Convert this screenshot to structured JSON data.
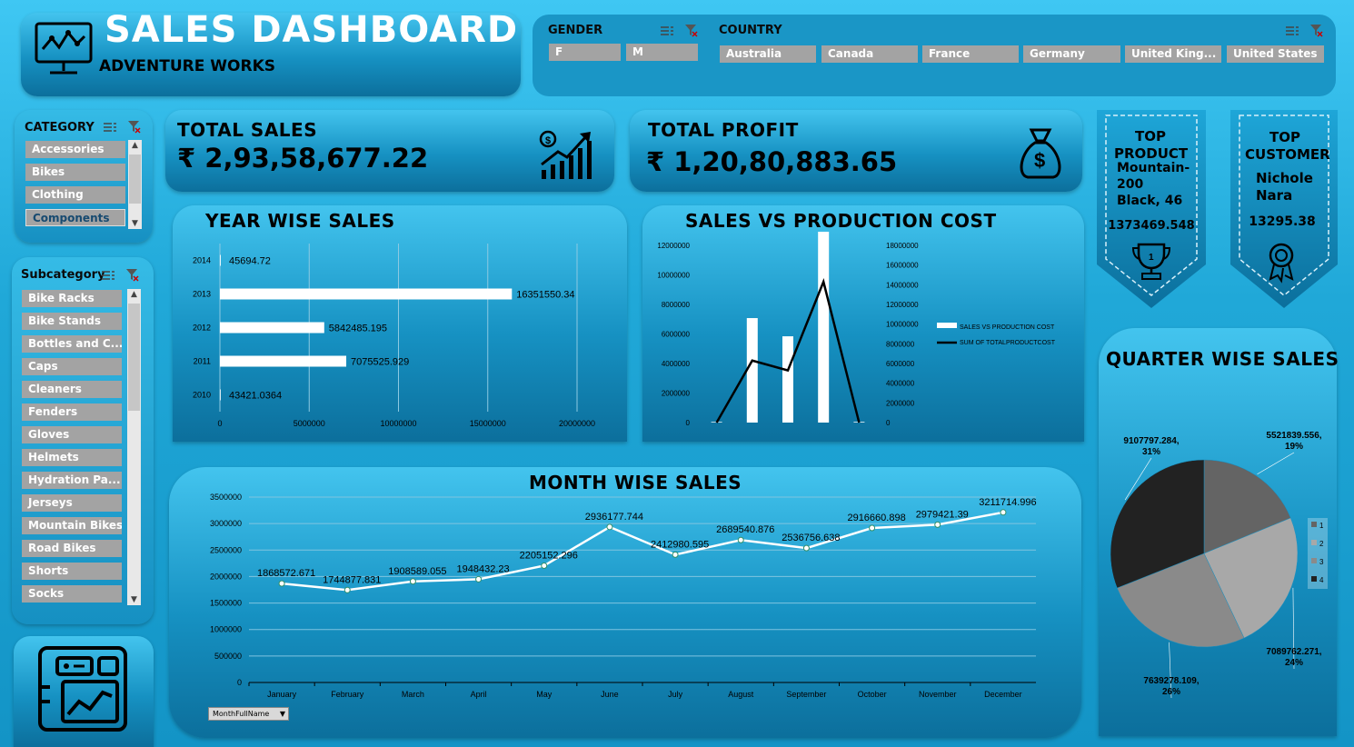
{
  "header": {
    "title": "SALES DASHBOARD",
    "subtitle": "ADVENTURE WORKS"
  },
  "gender": {
    "title": "GENDER",
    "items": [
      "F",
      "M"
    ]
  },
  "country": {
    "title": "COUNTRY",
    "items": [
      "Australia",
      "Canada",
      "France",
      "Germany",
      "United King...",
      "United States"
    ]
  },
  "category": {
    "title": "CATEGORY",
    "items": [
      "Accessories",
      "Bikes",
      "Clothing",
      "Components"
    ]
  },
  "subcategory": {
    "title": "Subcategory",
    "items": [
      "Bike Racks",
      "Bike Stands",
      "Bottles and C...",
      "Caps",
      "Cleaners",
      "Fenders",
      "Gloves",
      "Helmets",
      "Hydration Pa...",
      "Jerseys",
      "Mountain Bikes",
      "Road Bikes",
      "Shorts",
      "Socks"
    ]
  },
  "kpi": {
    "sales": {
      "title": "TOTAL SALES",
      "value": "₹ 2,93,58,677.22"
    },
    "profit": {
      "title": "TOTAL PROFIT",
      "value": "₹ 1,20,80,883.65"
    }
  },
  "top_product": {
    "title": "TOP PRODUCT",
    "name": "Mountain-200 Black, 46",
    "value": "1373469.548"
  },
  "top_customer": {
    "title": "TOP CUSTOMER",
    "name": "Nichole Nara",
    "value": "13295.38"
  },
  "month_filter": "MonthFullName",
  "colors": {
    "accent": "#1691c2",
    "panel_top": "#43c4ee",
    "bar": "#ffffff",
    "line": "#000000"
  },
  "chart_data": [
    {
      "type": "bar",
      "title": "YEAR WISE SALES",
      "orientation": "horizontal",
      "categories": [
        "2010",
        "2011",
        "2012",
        "2013",
        "2014"
      ],
      "values": [
        43421.0364,
        7075525.929,
        5842485.195,
        16351550.34,
        45694.72
      ],
      "value_labels": [
        "43421.0364",
        "7075525.929",
        "5842485.195",
        "16351550.34",
        "45694.72"
      ],
      "xlim": [
        0,
        20000000
      ],
      "xticks": [
        "0",
        "5000000",
        "10000000",
        "15000000",
        "20000000"
      ],
      "grid": "vertical"
    },
    {
      "type": "bar",
      "title": "SALES VS PRODUCTION COST",
      "categories": [
        "2010",
        "2011",
        "2012",
        "2013",
        "2014"
      ],
      "series": [
        {
          "name": "SALES VS PRODUCTION COST",
          "kind": "bar",
          "axis": "left",
          "values": [
            43421.0364,
            7075525.929,
            5842485.195,
            16351550.34,
            45694.72
          ]
        },
        {
          "name": "SUM OF TOTALPRODUCTCOST",
          "kind": "line",
          "axis": "right",
          "values": [
            0,
            6300000,
            5300000,
            14300000,
            0
          ]
        }
      ],
      "ylim_left": [
        0,
        12000000
      ],
      "yticks_left": [
        "0",
        "2000000",
        "4000000",
        "6000000",
        "8000000",
        "10000000",
        "12000000"
      ],
      "ylim_right": [
        0,
        18000000
      ],
      "yticks_right": [
        "0",
        "2000000",
        "4000000",
        "6000000",
        "8000000",
        "10000000",
        "12000000",
        "14000000",
        "16000000",
        "18000000"
      ],
      "legend": "right"
    },
    {
      "type": "line",
      "title": "MONTH WISE SALES",
      "categories": [
        "January",
        "February",
        "March",
        "April",
        "May",
        "June",
        "July",
        "August",
        "September",
        "October",
        "November",
        "December"
      ],
      "values": [
        1868572.671,
        1744877.831,
        1908589.055,
        1948432.23,
        2205152.296,
        2936177.744,
        2412980.595,
        2689540.876,
        2536756.638,
        2916660.898,
        2979421.39,
        3211714.996
      ],
      "value_labels": [
        "1868572.671",
        "1744877.831",
        "1908589.055",
        "1948432.23",
        "2205152.296",
        "2936177.744",
        "2412980.595",
        "2689540.876",
        "2536756.638",
        "2916660.898",
        "2979421.39",
        "3211714.996"
      ],
      "ylim": [
        0,
        3500000
      ],
      "yticks": [
        "0",
        "500000",
        "1000000",
        "1500000",
        "2000000",
        "2500000",
        "3000000",
        "3500000"
      ],
      "grid": "horizontal"
    },
    {
      "type": "pie",
      "title": "QUARTER WISE SALES",
      "labels": [
        "1",
        "2",
        "3",
        "4"
      ],
      "values": [
        5521839.556,
        7089762.271,
        7639278.109,
        9107797.284
      ],
      "slice_labels": [
        "5521839.556, 19%",
        "7089762.271, 24%",
        "7639278.109, 26%",
        "9107797.284, 31%"
      ],
      "colors": [
        "#646464",
        "#a8a8a8",
        "#8a8a8a",
        "#222222"
      ],
      "legend": "right"
    }
  ]
}
